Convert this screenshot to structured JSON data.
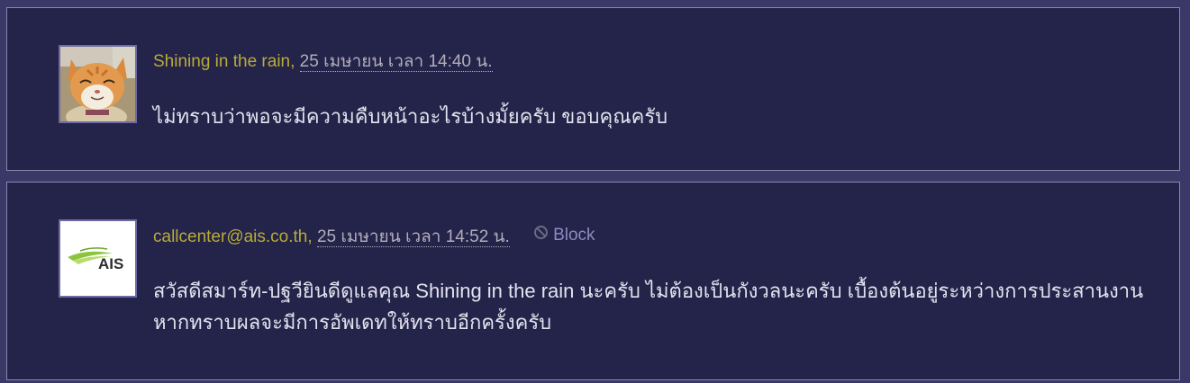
{
  "comments": [
    {
      "author": "Shining in the rain",
      "separator": ",",
      "date": "25 เมษายน เวลา 14:40 น.",
      "text": "ไม่ทราบว่าพอจะมีความคืบหน้าอะไรบ้างมั้ยครับ ขอบคุณครับ",
      "avatar": "cat-avatar"
    },
    {
      "author": "callcenter@ais.co.th",
      "separator": ",",
      "date": "25 เมษายน เวลา 14:52 น.",
      "block_label": "Block",
      "text": "สวัสดีสมาร์ท-ปฐวียินดีดูแลคุณ Shining in the rain นะครับ ไม่ต้องเป็นกังวลนะครับ เบื้องต้นอยู่ระหว่างการประสานงานหากทราบผลจะมีการอัพเดทให้ทราบอีกครั้งครับ",
      "avatar": "ais-logo",
      "logo_text": "AIS"
    }
  ],
  "colors": {
    "page_background": "#3b3868",
    "card_background": "#24234a",
    "author": "#b7ac38",
    "date": "#b1aeba",
    "block": "#8d8ac0",
    "body_text": "#e3e2ee",
    "ais_green": "#8cc43f"
  }
}
